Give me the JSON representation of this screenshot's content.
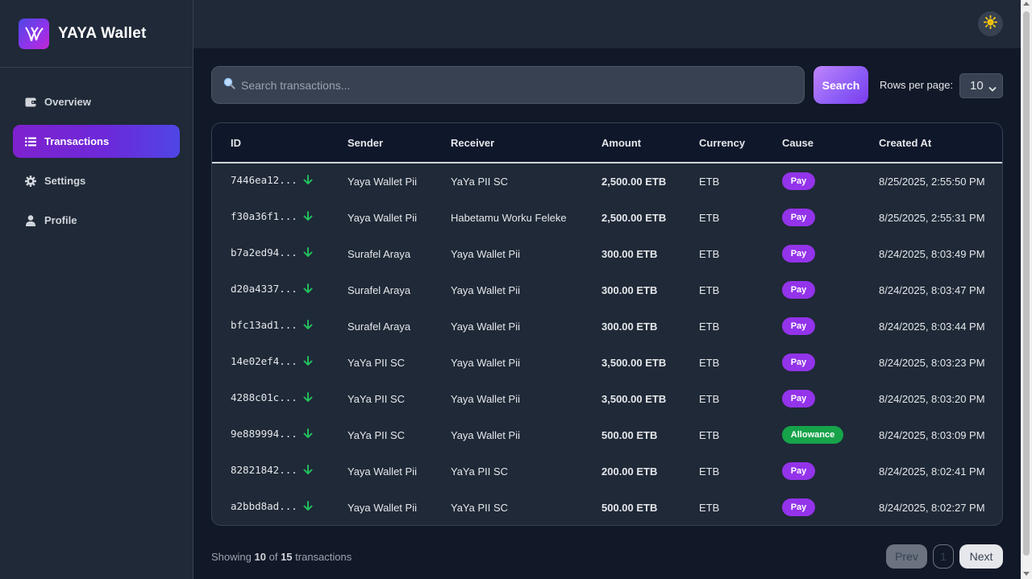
{
  "brand": {
    "name": "YAYA Wallet"
  },
  "nav": {
    "items": [
      {
        "label": "Overview",
        "icon": "wallet-icon",
        "active": false
      },
      {
        "label": "Transactions",
        "icon": "list-icon",
        "active": true
      },
      {
        "label": "Settings",
        "icon": "gear-icon",
        "active": false
      },
      {
        "label": "Profile",
        "icon": "user-icon",
        "active": false
      }
    ]
  },
  "header": {
    "theme_icon": "sun-icon"
  },
  "search": {
    "placeholder": "Search transactions...",
    "value": "",
    "button_label": "Search"
  },
  "rows_per_page": {
    "label": "Rows per page:",
    "value": "10"
  },
  "table": {
    "columns": [
      "ID",
      "Sender",
      "Receiver",
      "Amount",
      "Currency",
      "Cause",
      "Created At"
    ],
    "rows": [
      {
        "id": "7446ea12...",
        "direction": "incoming",
        "sender": "Yaya Wallet Pii",
        "receiver": "YaYa PII SC",
        "amount": "2,500.00 ETB",
        "currency": "ETB",
        "cause": "Pay",
        "created_at": "8/25/2025, 2:55:50 PM"
      },
      {
        "id": "f30a36f1...",
        "direction": "incoming",
        "sender": "Yaya Wallet Pii",
        "receiver": "Habetamu Worku Feleke",
        "amount": "2,500.00 ETB",
        "currency": "ETB",
        "cause": "Pay",
        "created_at": "8/25/2025, 2:55:31 PM"
      },
      {
        "id": "b7a2ed94...",
        "direction": "incoming",
        "sender": "Surafel Araya",
        "receiver": "Yaya Wallet Pii",
        "amount": "300.00 ETB",
        "currency": "ETB",
        "cause": "Pay",
        "created_at": "8/24/2025, 8:03:49 PM"
      },
      {
        "id": "d20a4337...",
        "direction": "incoming",
        "sender": "Surafel Araya",
        "receiver": "Yaya Wallet Pii",
        "amount": "300.00 ETB",
        "currency": "ETB",
        "cause": "Pay",
        "created_at": "8/24/2025, 8:03:47 PM"
      },
      {
        "id": "bfc13ad1...",
        "direction": "incoming",
        "sender": "Surafel Araya",
        "receiver": "Yaya Wallet Pii",
        "amount": "300.00 ETB",
        "currency": "ETB",
        "cause": "Pay",
        "created_at": "8/24/2025, 8:03:44 PM"
      },
      {
        "id": "14e02ef4...",
        "direction": "incoming",
        "sender": "YaYa PII SC",
        "receiver": "Yaya Wallet Pii",
        "amount": "3,500.00 ETB",
        "currency": "ETB",
        "cause": "Pay",
        "created_at": "8/24/2025, 8:03:23 PM"
      },
      {
        "id": "4288c01c...",
        "direction": "incoming",
        "sender": "YaYa PII SC",
        "receiver": "Yaya Wallet Pii",
        "amount": "3,500.00 ETB",
        "currency": "ETB",
        "cause": "Pay",
        "created_at": "8/24/2025, 8:03:20 PM"
      },
      {
        "id": "9e889994...",
        "direction": "incoming",
        "sender": "YaYa PII SC",
        "receiver": "Yaya Wallet Pii",
        "amount": "500.00 ETB",
        "currency": "ETB",
        "cause": "Allowance",
        "created_at": "8/24/2025, 8:03:09 PM"
      },
      {
        "id": "82821842...",
        "direction": "incoming",
        "sender": "Yaya Wallet Pii",
        "receiver": "YaYa PII SC",
        "amount": "200.00 ETB",
        "currency": "ETB",
        "cause": "Pay",
        "created_at": "8/24/2025, 8:02:41 PM"
      },
      {
        "id": "a2bbd8ad...",
        "direction": "incoming",
        "sender": "Yaya Wallet Pii",
        "receiver": "YaYa PII SC",
        "amount": "500.00 ETB",
        "currency": "ETB",
        "cause": "Pay",
        "created_at": "8/24/2025, 8:02:27 PM"
      }
    ]
  },
  "footer": {
    "showing_prefix": "Showing",
    "showing_count": "10",
    "showing_of": "of",
    "showing_total": "15",
    "showing_suffix": "transactions",
    "prev_label": "Prev",
    "page_number": "1",
    "next_label": "Next"
  },
  "colors": {
    "accent_purple": "#9333ea",
    "allowance_green": "#16a34a",
    "incoming_arrow": "#22c55e",
    "background": "#111827",
    "panel": "#1f2937"
  }
}
